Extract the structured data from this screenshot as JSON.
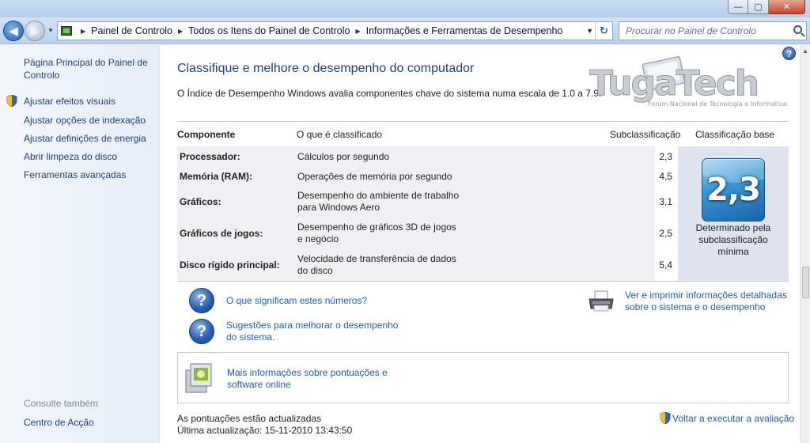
{
  "window": {
    "minimize_label": "—",
    "maximize_label": "▢",
    "close_label": "✕"
  },
  "address_bar": {
    "crumbs": [
      "Painel de Controlo",
      "Todos os Itens do Painel de Controlo",
      "Informações e Ferramentas de Desempenho"
    ],
    "search_placeholder": "Procurar no Painel de Controlo"
  },
  "sidebar": {
    "home_link": "Página Principal do Painel de Controlo",
    "links": [
      {
        "label": "Ajustar efeitos visuais",
        "shield": true
      },
      {
        "label": "Ajustar opções de indexação",
        "shield": false
      },
      {
        "label": "Ajustar definições de energia",
        "shield": false
      },
      {
        "label": "Abrir limpeza do disco",
        "shield": false
      },
      {
        "label": "Ferramentas avançadas",
        "shield": false
      }
    ],
    "see_also_heading": "Consulte também",
    "see_also_links": [
      "Centro de Acção"
    ]
  },
  "main": {
    "title": "Classifique e melhore o desempenho do computador",
    "description": "O Índice de Desempenho Windows avalia componentes chave do sistema numa escala de 1.0 a 7.9.",
    "table": {
      "headers": {
        "component": "Componente",
        "rated": "O que é classificado",
        "subscore": "Subclassificação",
        "basescore": "Classificação base"
      },
      "rows": [
        {
          "component": "Processador:",
          "description": "Cálculos por segundo",
          "subscore": "2,3"
        },
        {
          "component": "Memória (RAM):",
          "description": "Operações de memória por segundo",
          "subscore": "4,5"
        },
        {
          "component": "Gráficos:",
          "description": "Desempenho do ambiente de trabalho para Windows Aero",
          "subscore": "3,1"
        },
        {
          "component": "Gráficos de jogos:",
          "description": "Desempenho de gráficos 3D de jogos e negócio",
          "subscore": "2,5"
        },
        {
          "component": "Disco rígido principal:",
          "description": "Velocidade de transferência de dados do disco",
          "subscore": "5,4"
        }
      ],
      "base_score": "2,3",
      "base_caption": "Determinado pela subclassificação mínima"
    },
    "links": {
      "what_numbers_mean": "O que significam estes números?",
      "tips": "Sugestões para melhorar o desempenho do sistema.",
      "print_details": "Ver e imprimir informações detalhadas sobre o sistema e o desempenho",
      "more_info": "Mais informações sobre pontuações e software online"
    },
    "footer": {
      "status": "As pontuações estão actualizadas",
      "last_update": "Última actualização: 15-11-2010 13:43:50",
      "rerun": "Voltar a executar a avaliação"
    },
    "watermark": {
      "brand": "TugaTech",
      "tagline": "Forum Nacional de Tecnologia e Informatica"
    }
  },
  "colors": {
    "link": "#1e5ca8",
    "title": "#1f3e74",
    "badge": "#3a98d6"
  }
}
